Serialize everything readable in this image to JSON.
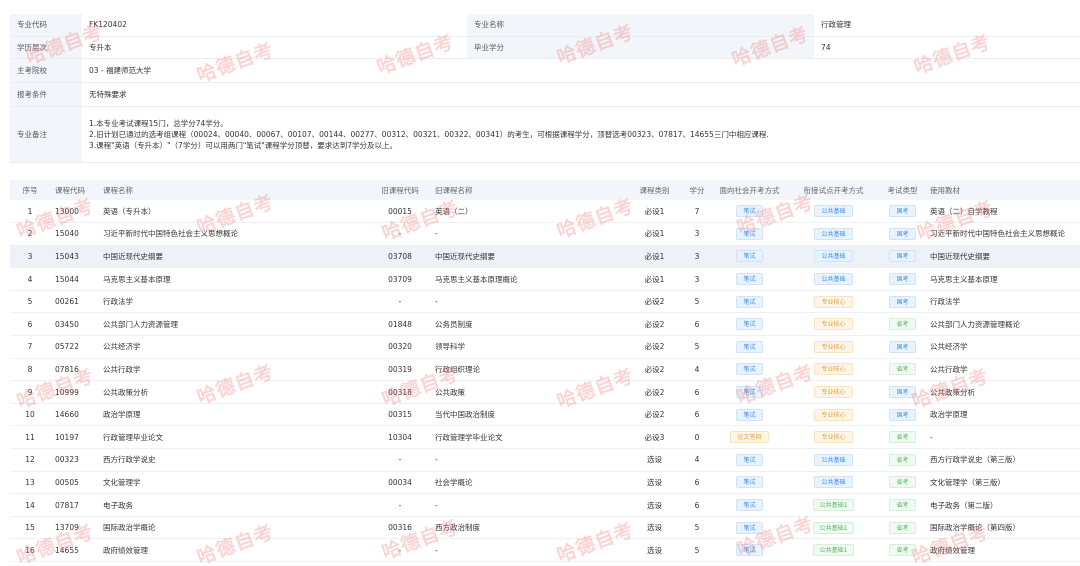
{
  "info": {
    "major_code_label": "专业代码",
    "major_code": "FK120402",
    "major_name_label": "专业名称",
    "major_name": "行政管理",
    "level_label": "学历层次",
    "level": "专升本",
    "credits_label": "毕业学分",
    "credits": "74",
    "school_label": "主考院校",
    "school": "03 - 福建师范大学",
    "condition_label": "报考条件",
    "condition": "无特殊要求",
    "notes_label": "专业备注",
    "notes": [
      "1.本专业考试课程15门，总学分74学分。",
      "2.旧计划已通过的选考组课程（00024、00040、00067、00107、00144、00277、00312、00321、00322、00341）的考生，可根据课程学分，顶替选考00323、07817、14655三门中相应课程.",
      "3.课程\"英语（专升本）\"（7学分）可以用两门\"笔试\"课程学分顶替，要求达到7学分及以上。"
    ]
  },
  "columns": [
    "序号",
    "课程代码",
    "课程名称",
    "旧课程代码",
    "旧课程名称",
    "课程类别",
    "学分",
    "面向社会开考方式",
    "衔接试点开考方式",
    "考试类型",
    "使用教材"
  ],
  "courses": [
    {
      "no": "1",
      "code": "13000",
      "name": "英语（专升本）",
      "old_code": "00015",
      "old_name": "英语（二）",
      "type": "必设1",
      "credit": "7",
      "social": "笔试",
      "pilot": "公共基础",
      "exam": "国考",
      "book": "英语（二）自学教程"
    },
    {
      "no": "2",
      "code": "15040",
      "name": "习近平新时代中国特色社会主义思想概论",
      "old_code": "-",
      "old_name": "-",
      "type": "必设1",
      "credit": "3",
      "social": "笔试",
      "pilot": "公共基础",
      "exam": "国考",
      "book": "习近平新时代中国特色社会主义思想概论"
    },
    {
      "no": "3",
      "code": "15043",
      "name": "中国近现代史纲要",
      "old_code": "03708",
      "old_name": "中国近现代史纲要",
      "type": "必设1",
      "credit": "3",
      "social": "笔试",
      "pilot": "公共基础",
      "exam": "国考",
      "book": "中国近现代史纲要"
    },
    {
      "no": "4",
      "code": "15044",
      "name": "马克思主义基本原理",
      "old_code": "03709",
      "old_name": "马克思主义基本原理概论",
      "type": "必设1",
      "credit": "3",
      "social": "笔试",
      "pilot": "公共基础",
      "exam": "国考",
      "book": "马克思主义基本原理"
    },
    {
      "no": "5",
      "code": "00261",
      "name": "行政法学",
      "old_code": "-",
      "old_name": "-",
      "type": "必设2",
      "credit": "5",
      "social": "笔试",
      "pilot": "专业核心",
      "exam": "国考",
      "book": "行政法学"
    },
    {
      "no": "6",
      "code": "03450",
      "name": "公共部门人力资源管理",
      "old_code": "01848",
      "old_name": "公务员制度",
      "type": "必设2",
      "credit": "6",
      "social": "笔试",
      "pilot": "专业核心",
      "exam": "省考",
      "book": "公共部门人力资源管理概论"
    },
    {
      "no": "7",
      "code": "05722",
      "name": "公共经济学",
      "old_code": "00320",
      "old_name": "领导科学",
      "type": "必设2",
      "credit": "5",
      "social": "笔试",
      "pilot": "专业核心",
      "exam": "国考",
      "book": "公共经济学"
    },
    {
      "no": "8",
      "code": "07816",
      "name": "公共行政学",
      "old_code": "00319",
      "old_name": "行政组织理论",
      "type": "必设2",
      "credit": "4",
      "social": "笔试",
      "pilot": "专业核心",
      "exam": "省考",
      "book": "公共行政学"
    },
    {
      "no": "9",
      "code": "10999",
      "name": "公共政策分析",
      "old_code": "00318",
      "old_name": "公共政策",
      "type": "必设2",
      "credit": "6",
      "social": "笔试",
      "pilot": "专业核心",
      "exam": "国考",
      "book": "公共政策分析"
    },
    {
      "no": "10",
      "code": "14660",
      "name": "政治学原理",
      "old_code": "00315",
      "old_name": "当代中国政治制度",
      "type": "必设2",
      "credit": "6",
      "social": "笔试",
      "pilot": "专业核心",
      "exam": "国考",
      "book": "政治学原理"
    },
    {
      "no": "11",
      "code": "10197",
      "name": "行政管理毕业论文",
      "old_code": "10304",
      "old_name": "行政管理学毕业论文",
      "type": "必设3",
      "credit": "0",
      "social": "论文答辩",
      "pilot": "专业核心",
      "exam": "省考",
      "book": "-"
    },
    {
      "no": "12",
      "code": "00323",
      "name": "西方行政学说史",
      "old_code": "-",
      "old_name": "-",
      "type": "选设",
      "credit": "4",
      "social": "笔试",
      "pilot": "公共基础",
      "exam": "省考",
      "book": "西方行政学说史（第三版）"
    },
    {
      "no": "13",
      "code": "00505",
      "name": "文化管理学",
      "old_code": "00034",
      "old_name": "社会学概论",
      "type": "选设",
      "credit": "6",
      "social": "笔试",
      "pilot": "公共基础",
      "exam": "省考",
      "book": "文化管理学（第三版）"
    },
    {
      "no": "14",
      "code": "07817",
      "name": "电子政务",
      "old_code": "-",
      "old_name": "-",
      "type": "选设",
      "credit": "6",
      "social": "笔试",
      "pilot": "公共基础1",
      "exam": "省考",
      "book": "电子政务（第二版）"
    },
    {
      "no": "15",
      "code": "13709",
      "name": "国际政治学概论",
      "old_code": "00316",
      "old_name": "西方政治制度",
      "type": "选设",
      "credit": "5",
      "social": "笔试",
      "pilot": "公共基础1",
      "exam": "省考",
      "book": "国际政治学概论（第四版）"
    },
    {
      "no": "16",
      "code": "14655",
      "name": "政府绩效管理",
      "old_code": "-",
      "old_name": "-",
      "type": "选设",
      "credit": "5",
      "social": "笔试",
      "pilot": "公共基础1",
      "exam": "省考",
      "book": "政府绩效管理"
    }
  ],
  "watermark": "哈德自考",
  "colors": {
    "label_bg": "#f2f5fa",
    "blue_tag": "#3a8ee6",
    "orange_tag": "#e6a23c",
    "green_tag": "#5bb85d",
    "highlight_row": "#eef1f6"
  }
}
